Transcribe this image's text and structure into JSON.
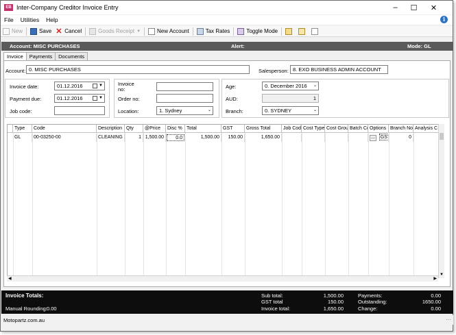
{
  "window": {
    "title": "Inter-Company Creditor Invoice Entry",
    "app_icon": "EB"
  },
  "menu": [
    "File",
    "Utilities",
    "Help"
  ],
  "toolbar": {
    "new": "New",
    "save": "Save",
    "cancel": "Cancel",
    "goods_receipt": "Goods Receipt",
    "new_account": "New Account",
    "tax_rates": "Tax Rates",
    "toggle_mode": "Toggle Mode"
  },
  "header": {
    "account": "Account: MISC PURCHASES",
    "alert": "Alert:",
    "mode": "Mode: GL"
  },
  "tabs": [
    "Invoice",
    "Payments",
    "Documents"
  ],
  "form": {
    "account_label": "Account:",
    "account_value": "0. MISC PURCHASES",
    "salesperson_label": "Salesperson:",
    "salesperson_value": "8. EXO BUSINESS ADMIN ACCOUNT",
    "invoice_date_label": "Invoice date:",
    "invoice_date_value": "01.12.2016",
    "payment_due_label": "Payment due:",
    "payment_due_value": "01.12.2016",
    "job_code_label": "Job code:",
    "job_code_value": "",
    "invoice_no_label": "Invoice\nno:",
    "invoice_no_value": "",
    "order_no_label": "Order no:",
    "order_no_value": "",
    "location_label": "Location:",
    "location_value": "1. Sydney",
    "age_label": "Age:",
    "age_value": "0. December 2016",
    "currency_label": "AUD:",
    "currency_value": "1",
    "branch_label": "Branch:",
    "branch_value": "0. SYDNEY"
  },
  "grid": {
    "columns": [
      "Type",
      "Code",
      "Description",
      "Qty",
      "@Price",
      "Disc %",
      "Total",
      "GST",
      "Gross Total",
      "Job Code",
      "Cost Type",
      "Cost Grou",
      "Batch Co",
      "Options",
      "Branch No",
      "Analysis C"
    ],
    "rows": [
      {
        "type": "GL",
        "code": "00-03250-00",
        "description": "CLEANING",
        "qty": "1",
        "price": "1,500.00",
        "disc": "0.0",
        "total": "1,500.00",
        "gst": "150.00",
        "gross": "1,650.00",
        "job_code": "",
        "cost_type": "",
        "cost_group": "",
        "batch": "",
        "options_btn": "...",
        "options_gst": "GST",
        "branch": "0",
        "analysis": ""
      }
    ]
  },
  "totals": {
    "title": "Invoice Totals:",
    "manual_rounding_label": "Manual Rounding:",
    "manual_rounding_value": "0.00",
    "sub_total_label": "Sub total:",
    "sub_total_value": "1,500.00",
    "gst_total_label": "GST total",
    "gst_total_value": "150.00",
    "invoice_total_label": "Invoice total:",
    "invoice_total_value": "1,650.00",
    "payments_label": "Payments:",
    "payments_value": "0.00",
    "outstanding_label": "Outstanding:",
    "outstanding_value": "1650.00",
    "change_label": "Change:",
    "change_value": "0.00"
  },
  "status": {
    "text": "Motopartz.com.au"
  },
  "colors": {
    "header_bg": "#5a5a5a",
    "footer_bg": "#0d0d0d",
    "app_icon": "#c0336a"
  }
}
